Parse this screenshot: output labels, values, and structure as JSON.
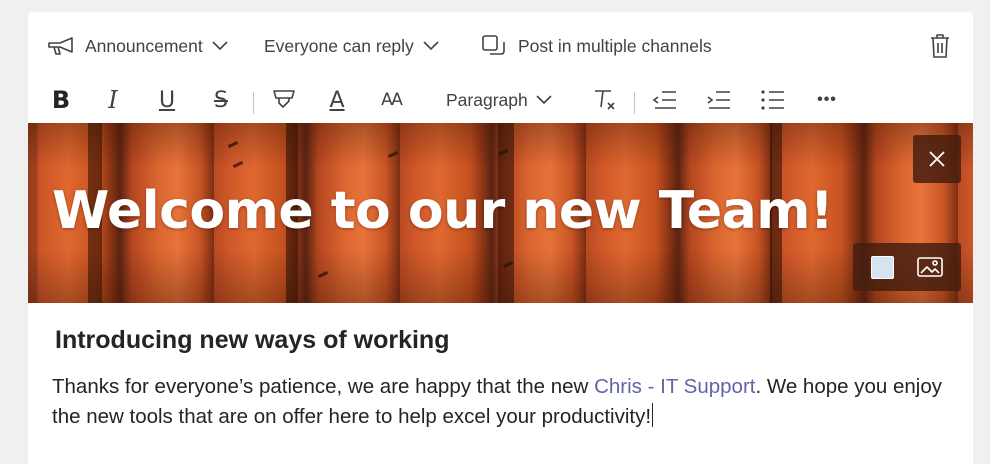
{
  "header": {
    "post_type": {
      "label": "Announcement",
      "icon": "megaphone-icon"
    },
    "reply_setting": {
      "label": "Everyone can reply"
    },
    "multi_channel": {
      "label": "Post in multiple channels",
      "icon": "copy-icon"
    },
    "delete": {
      "icon": "trash-icon"
    }
  },
  "toolbar": {
    "bold": "B",
    "italic": "I",
    "underline": "U",
    "strike": "S",
    "font_size": "AA",
    "font_color": "A",
    "paragraph_label": "Paragraph",
    "more": "•••"
  },
  "banner": {
    "title": "Welcome to our new Team!",
    "background_color": "#c4511f",
    "swatch_color": "#d6e4f2"
  },
  "content": {
    "subhead": "Introducing new ways of working",
    "body_before_mention": "Thanks for everyone’s patience, we are happy that the new ",
    "mention": "Chris - IT Support",
    "body_after_mention": ". We hope you enjoy the new tools that are on offer here to help excel your productivity!"
  },
  "colors": {
    "mention": "#6264a7",
    "text": "#252423",
    "toolbar_icon": "#424242"
  }
}
